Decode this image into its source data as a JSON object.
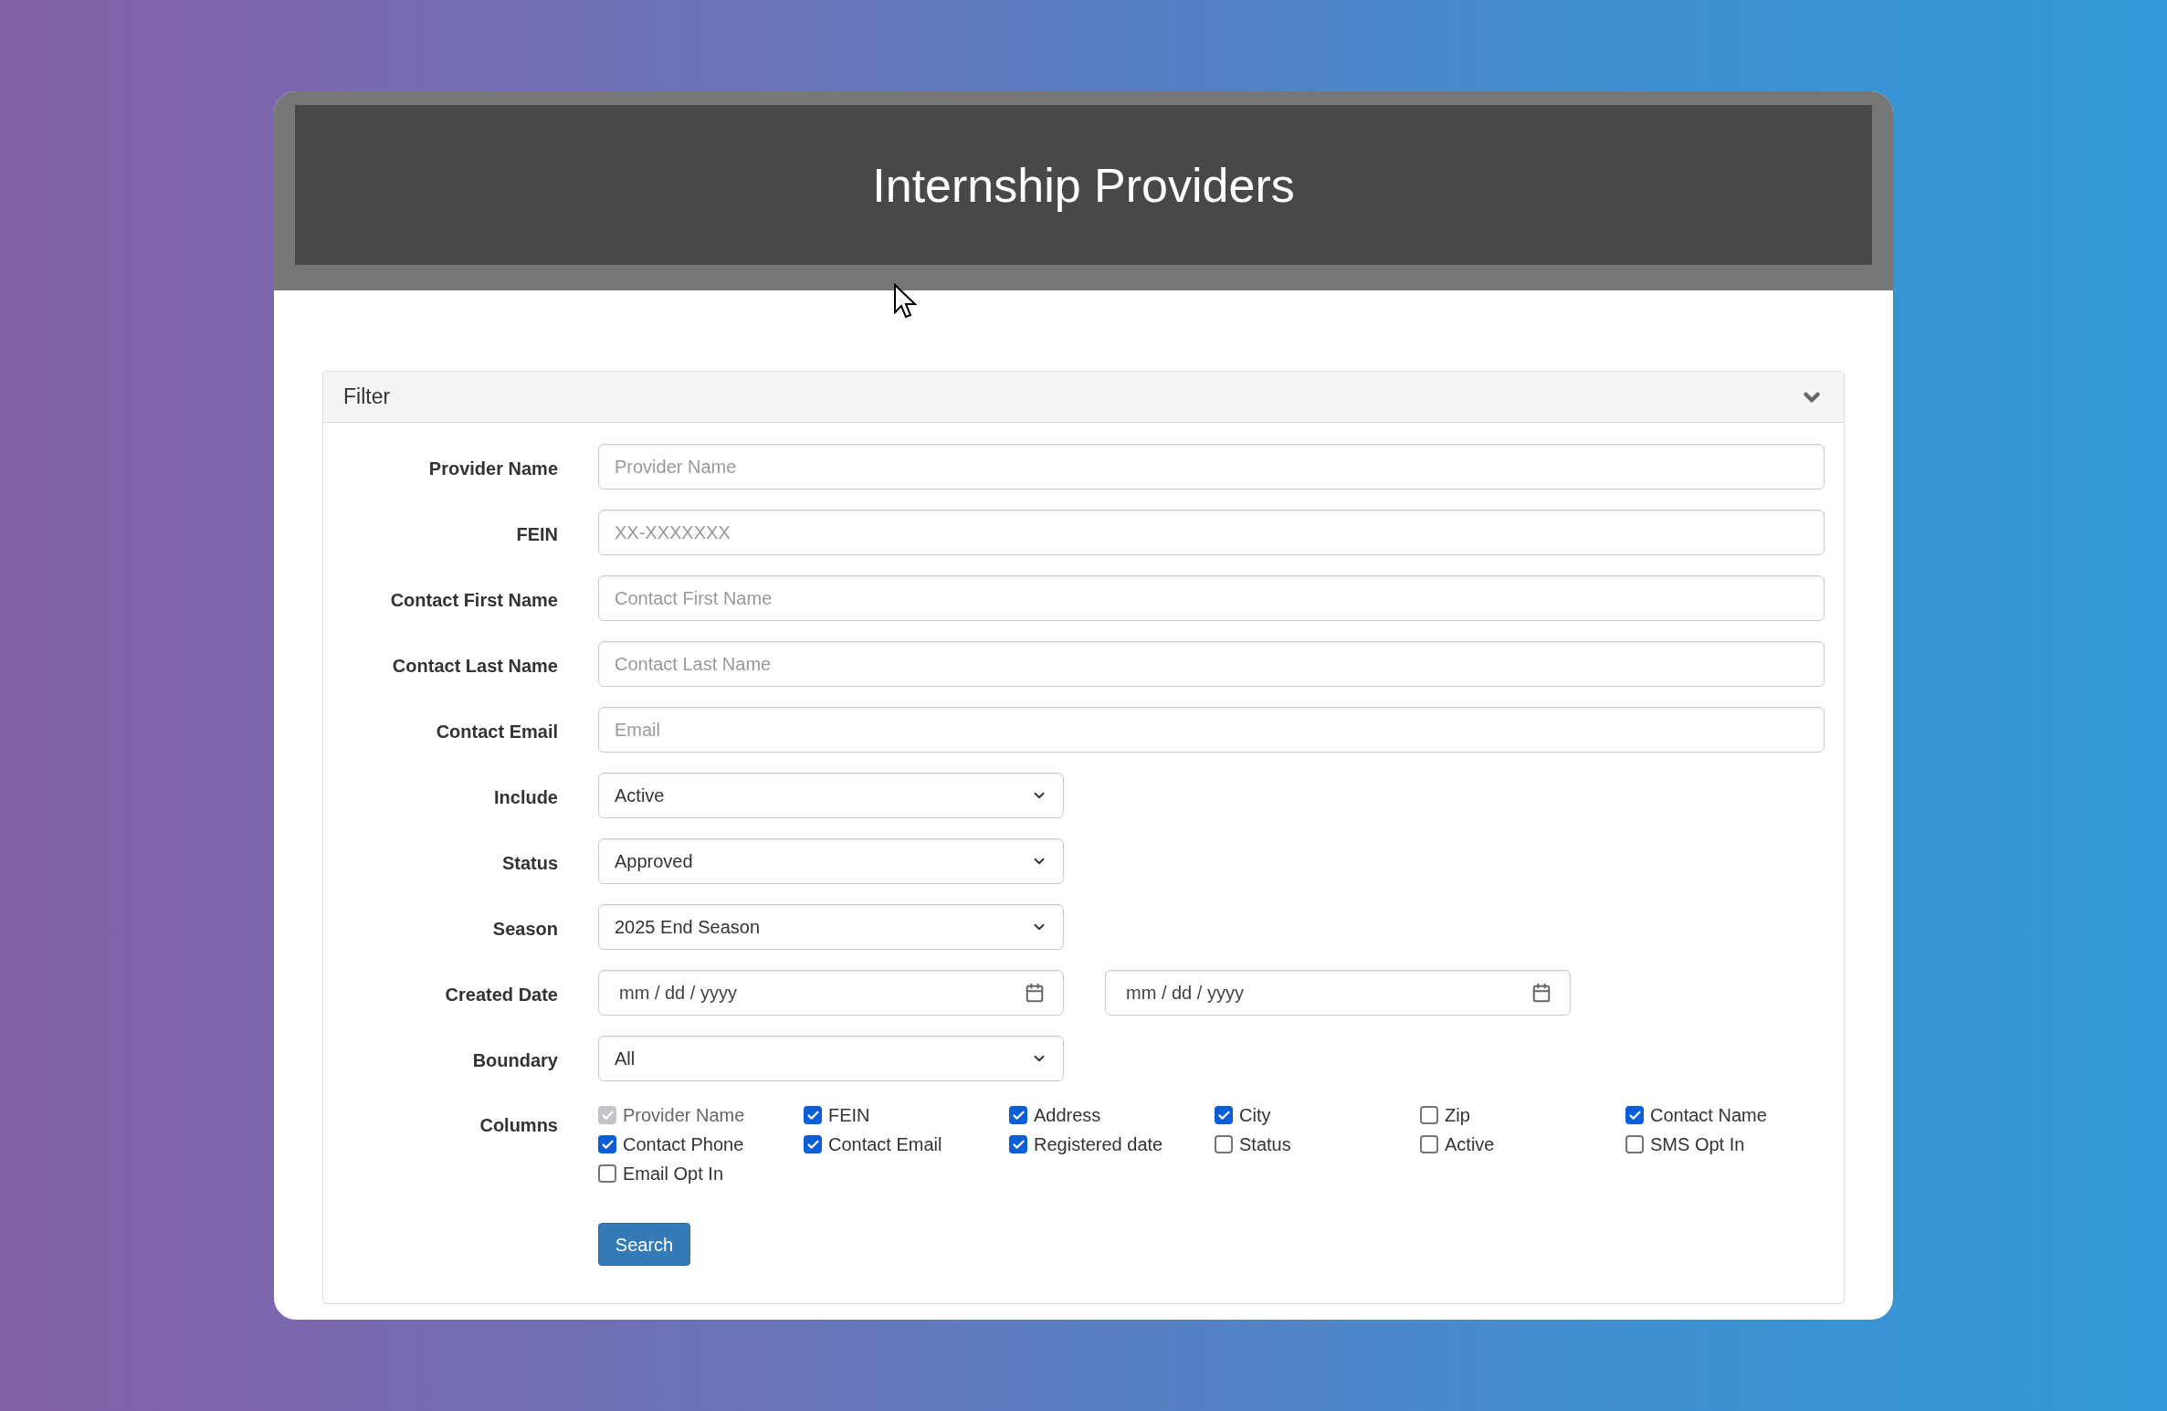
{
  "header": {
    "title": "Internship Providers"
  },
  "filter": {
    "title": "Filter",
    "expanded": true,
    "fields": [
      {
        "kind": "text",
        "label": "Provider Name",
        "placeholder": "Provider Name"
      },
      {
        "kind": "text",
        "label": "FEIN",
        "placeholder": "XX-XXXXXXX"
      },
      {
        "kind": "text",
        "label": "Contact First Name",
        "placeholder": "Contact First Name"
      },
      {
        "kind": "text",
        "label": "Contact Last Name",
        "placeholder": "Contact Last Name"
      },
      {
        "kind": "text",
        "label": "Contact Email",
        "placeholder": "Email"
      },
      {
        "kind": "select",
        "label": "Include",
        "value": "Active"
      },
      {
        "kind": "select",
        "label": "Status",
        "value": "Approved"
      },
      {
        "kind": "select",
        "label": "Season",
        "value": "2025 End Season"
      },
      {
        "kind": "date",
        "label": "Created Date",
        "dates": [
          "mm / dd / yyyy",
          "mm / dd / yyyy"
        ]
      },
      {
        "kind": "select",
        "label": "Boundary",
        "value": "All"
      }
    ],
    "columns_label": "Columns",
    "columns": [
      {
        "label": "Provider Name",
        "checked": true,
        "disabled": true
      },
      {
        "label": "FEIN",
        "checked": true,
        "disabled": false
      },
      {
        "label": "Address",
        "checked": true,
        "disabled": false
      },
      {
        "label": "City",
        "checked": true,
        "disabled": false
      },
      {
        "label": "Zip",
        "checked": false,
        "disabled": false
      },
      {
        "label": "Contact Name",
        "checked": true,
        "disabled": false
      },
      {
        "label": "Contact Phone",
        "checked": true,
        "disabled": false
      },
      {
        "label": "Contact Email",
        "checked": true,
        "disabled": false
      },
      {
        "label": "Registered date",
        "checked": true,
        "disabled": false
      },
      {
        "label": "Status",
        "checked": false,
        "disabled": false
      },
      {
        "label": "Active",
        "checked": false,
        "disabled": false
      },
      {
        "label": "SMS Opt In",
        "checked": false,
        "disabled": false
      },
      {
        "label": "Email Opt In",
        "checked": false,
        "disabled": false
      }
    ],
    "search_button": "Search"
  }
}
